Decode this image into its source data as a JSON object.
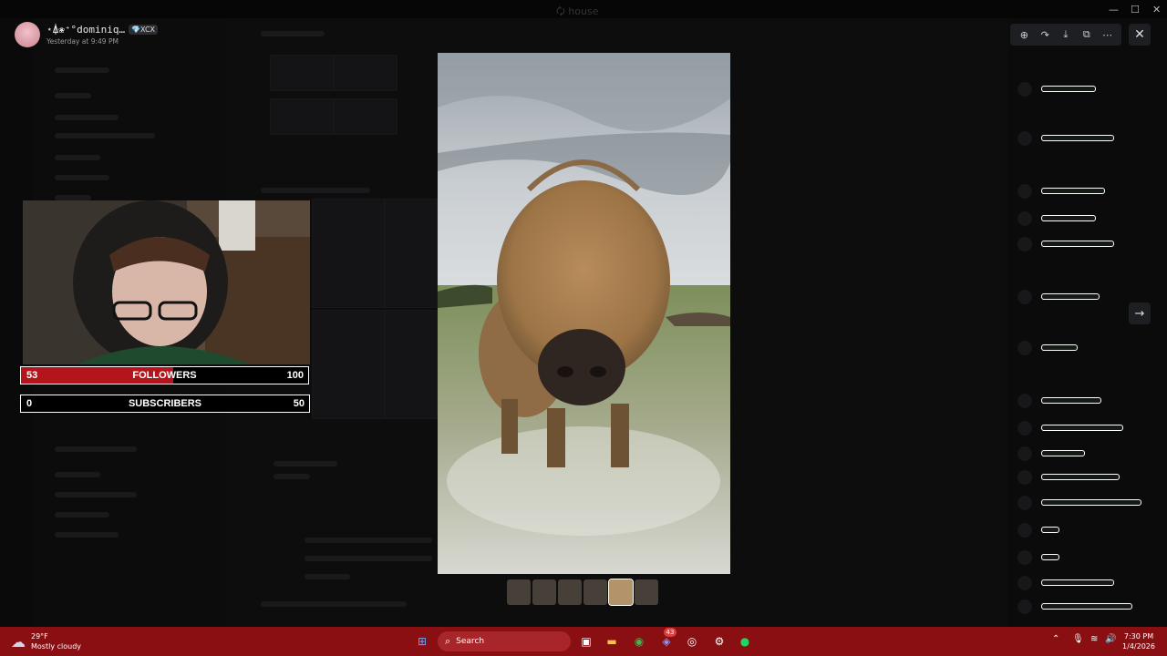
{
  "window": {
    "title": "🗘 house",
    "min": "—",
    "max": "☐",
    "close": "✕"
  },
  "viewer": {
    "author": {
      "name": "⋆⍋❀⁺°dominiq…",
      "tag": "💎XCX",
      "timestamp": "Yesterday at 9:49 PM"
    },
    "toolbar": [
      {
        "name": "zoom-icon",
        "glyph": "⊕"
      },
      {
        "name": "forward-icon",
        "glyph": "↷"
      },
      {
        "name": "download-icon",
        "glyph": "⤓"
      },
      {
        "name": "open-external-icon",
        "glyph": "⧉"
      },
      {
        "name": "more-icon",
        "glyph": "⋯"
      }
    ],
    "close_glyph": "✕",
    "next_glyph": "→",
    "thumbnails_count": 6,
    "active_thumbnail": 4
  },
  "stream": {
    "followers": {
      "current": "53",
      "label": "FOLLOWERS",
      "goal": "100",
      "progress": 0.53
    },
    "subscribers": {
      "current": "0",
      "label": "SUBSCRIBERS",
      "goal": "50",
      "progress": 0.0
    }
  },
  "taskbar": {
    "weather": {
      "temp": "29°F",
      "condition": "Mostly cloudy"
    },
    "search_placeholder": "Search",
    "discord_badge": "43",
    "time": "7:30 PM",
    "date": "1/4/2026"
  }
}
